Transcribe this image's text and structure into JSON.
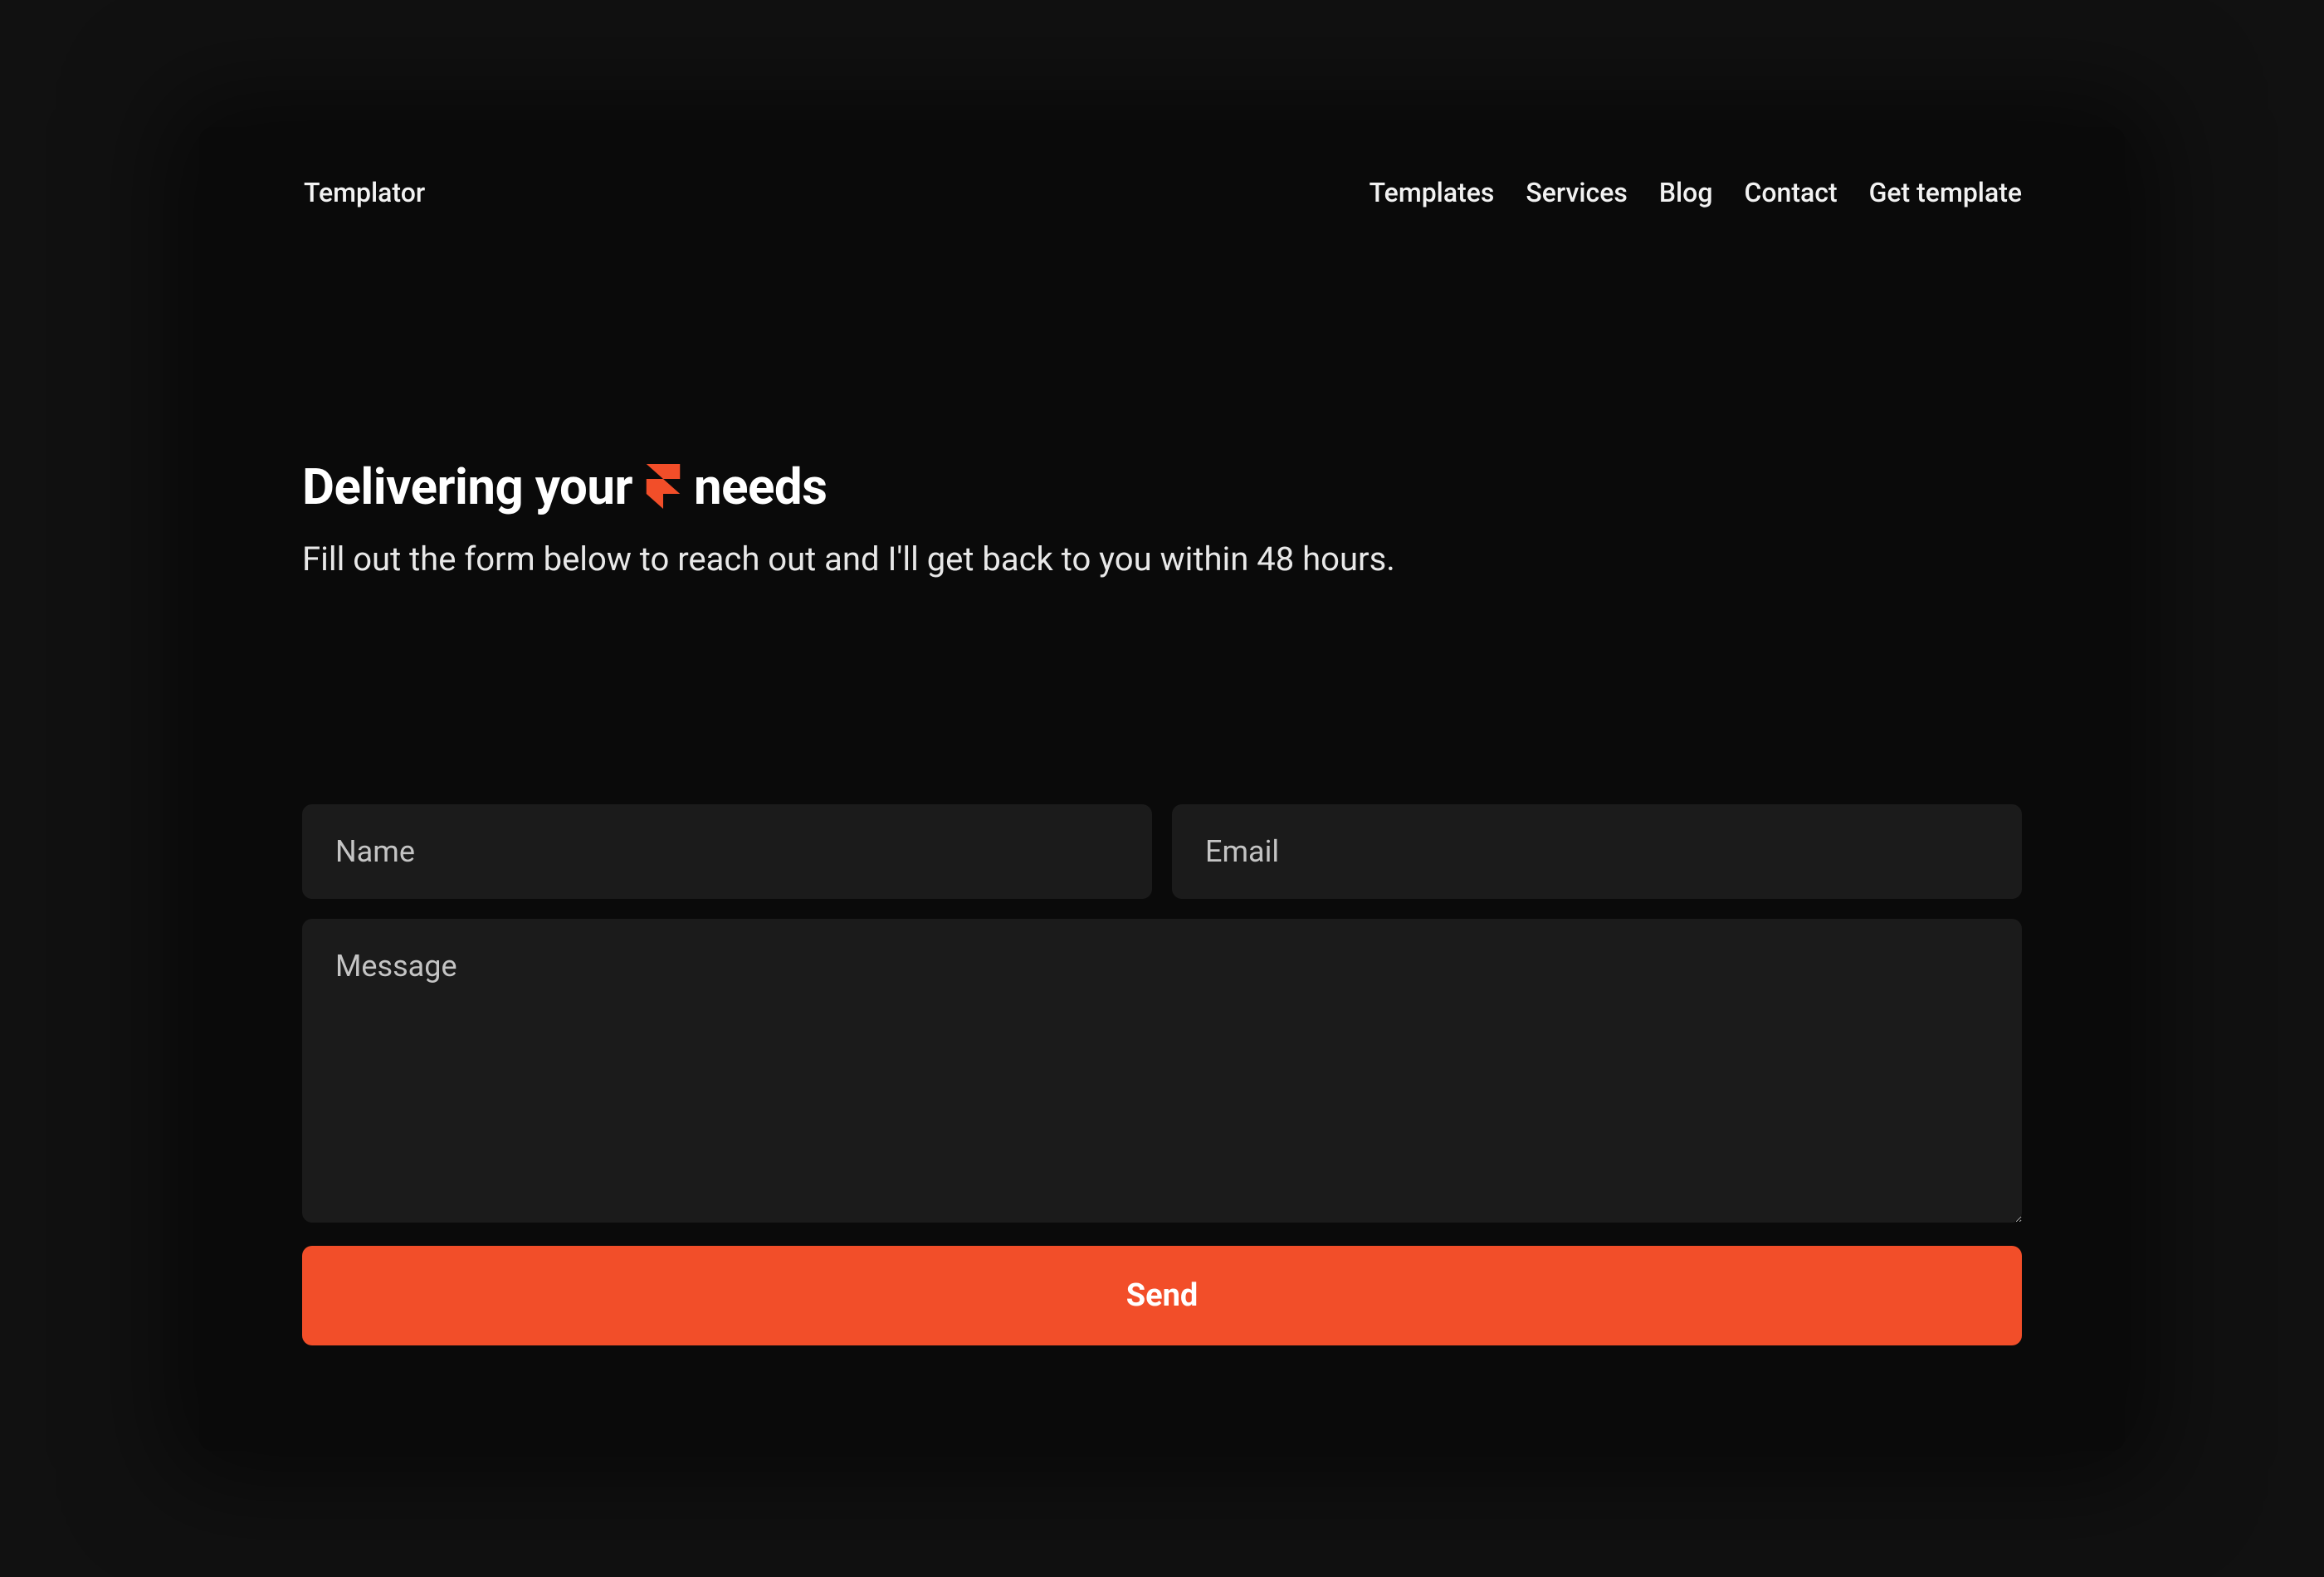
{
  "header": {
    "brand": "Templator",
    "nav": [
      {
        "label": "Templates"
      },
      {
        "label": "Services"
      },
      {
        "label": "Blog"
      },
      {
        "label": "Contact"
      },
      {
        "label": "Get template"
      }
    ]
  },
  "hero": {
    "title_pre": "Delivering your",
    "title_post": "needs",
    "subtitle": "Fill out the form below to reach out and I'll get back to you within 48 hours."
  },
  "form": {
    "name_placeholder": "Name",
    "email_placeholder": "Email",
    "message_placeholder": "Message",
    "submit_label": "Send"
  },
  "colors": {
    "accent": "#f24e29"
  }
}
